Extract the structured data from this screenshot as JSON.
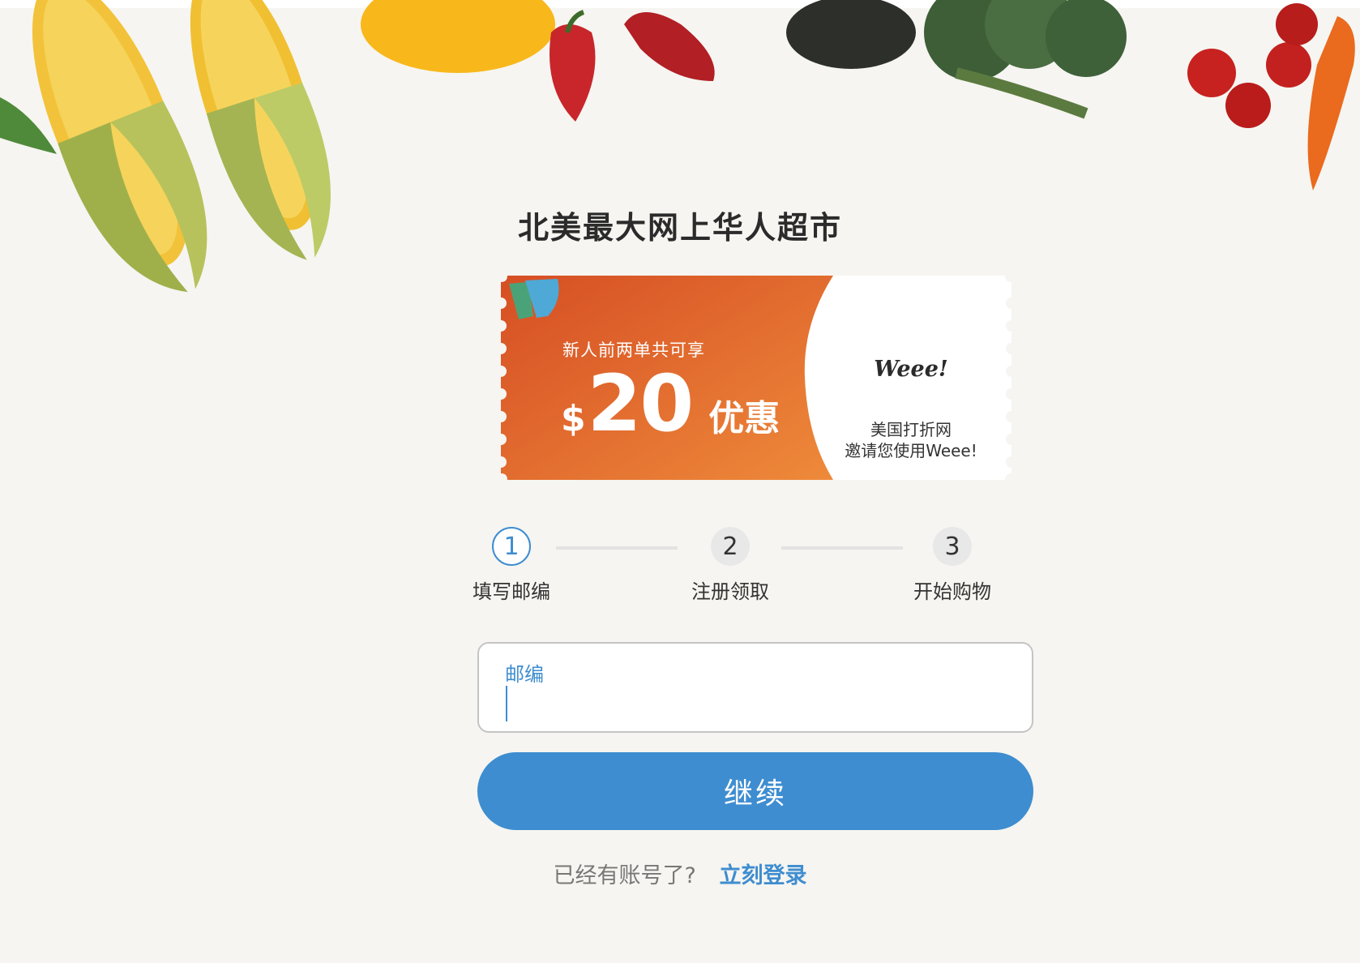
{
  "headline": "北美最大网上华人超市",
  "coupon": {
    "subtitle": "新人前两单共可享",
    "currency": "$",
    "amount": "20",
    "unit": "优惠",
    "brand": "Weee!",
    "invite_line1": "美国打折网",
    "invite_line2": "邀请您使用Weee!",
    "gradient_start": "#d64e24",
    "gradient_end": "#ee8a3a"
  },
  "steps": [
    {
      "number": "1",
      "label": "填写邮编"
    },
    {
      "number": "2",
      "label": "注册领取"
    },
    {
      "number": "3",
      "label": "开始购物"
    }
  ],
  "form": {
    "zip_label": "邮编",
    "zip_value": "",
    "continue_label": "继续"
  },
  "login": {
    "question": "已经有账号了?",
    "link": "立刻登录"
  },
  "colors": {
    "accent": "#3e8dd0",
    "background": "#f6f5f1"
  }
}
